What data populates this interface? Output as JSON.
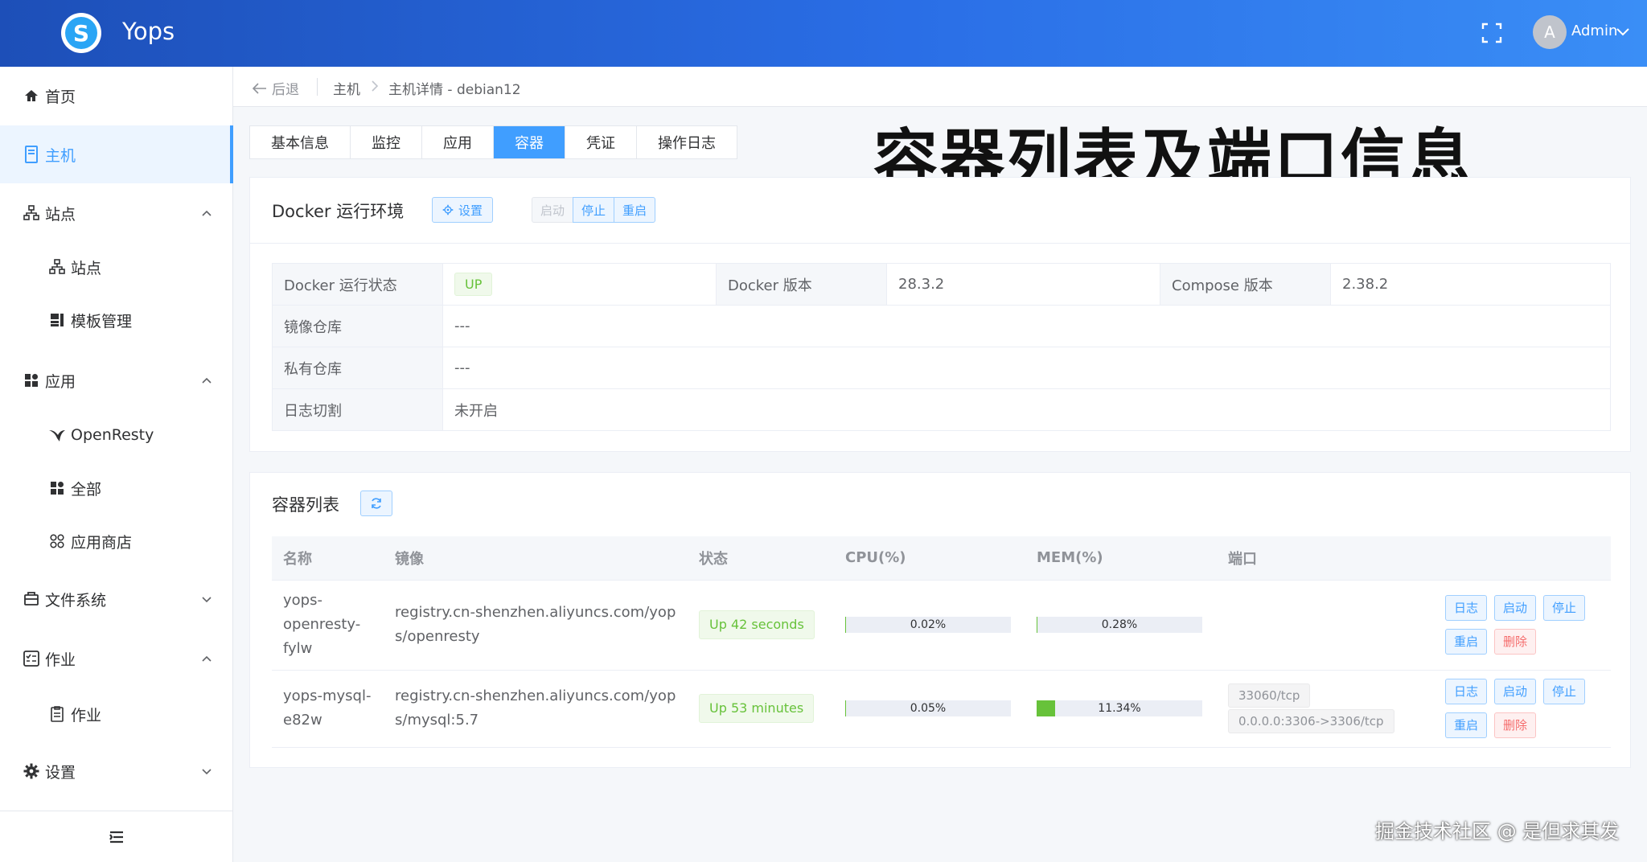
{
  "app": {
    "title": "Yops",
    "logo_letter": "S"
  },
  "header": {
    "user_initial": "A",
    "user_name": "Admin"
  },
  "sidebar": {
    "items": [
      {
        "label": "首页",
        "icon": "home-icon"
      },
      {
        "label": "主机",
        "icon": "server-icon",
        "active": true
      },
      {
        "label": "站点",
        "icon": "sitemap-icon",
        "expanded": true
      },
      {
        "label": "站点",
        "icon": "sitemap-icon",
        "sub": true
      },
      {
        "label": "模板管理",
        "icon": "template-icon",
        "sub": true
      },
      {
        "label": "应用",
        "icon": "apps-icon",
        "expanded": true
      },
      {
        "label": "OpenResty",
        "icon": "openresty-icon",
        "sub": true
      },
      {
        "label": "全部",
        "icon": "apps-icon",
        "sub": true
      },
      {
        "label": "应用商店",
        "icon": "store-icon",
        "sub": true
      },
      {
        "label": "文件系统",
        "icon": "folder-icon",
        "expanded": false
      },
      {
        "label": "作业",
        "icon": "task-icon",
        "expanded": true
      },
      {
        "label": "作业",
        "icon": "document-icon",
        "sub": true
      },
      {
        "label": "设置",
        "icon": "gear-icon",
        "expanded": false
      }
    ]
  },
  "breadcrumb": {
    "back": "后退",
    "parent": "主机",
    "current": "主机详情 - debian12"
  },
  "tabs": [
    "基本信息",
    "监控",
    "应用",
    "容器",
    "凭证",
    "操作日志"
  ],
  "active_tab": "容器",
  "overlay_title": "容器列表及端口信息",
  "docker_env": {
    "title": "Docker 运行环境",
    "setting_label": "设置",
    "buttons": {
      "start": "启动",
      "stop": "停止",
      "restart": "重启"
    },
    "status_label": "Docker 运行状态",
    "status_value": "UP",
    "version_label": "Docker 版本",
    "version_value": "28.3.2",
    "compose_label": "Compose 版本",
    "compose_value": "2.38.2",
    "registry_label": "镜像仓库",
    "registry_value": "---",
    "private_label": "私有仓库",
    "private_value": "---",
    "logrotate_label": "日志切割",
    "logrotate_value": "未开启"
  },
  "containers": {
    "title": "容器列表",
    "columns": {
      "name": "名称",
      "image": "镜像",
      "status": "状态",
      "cpu": "CPU(%)",
      "mem": "MEM(%)",
      "ports": "端口"
    },
    "actions": {
      "log": "日志",
      "start": "启动",
      "stop": "停止",
      "restart": "重启",
      "delete": "删除"
    },
    "rows": [
      {
        "name": "yops-openresty-fylw",
        "image": "registry.cn-shenzhen.aliyuncs.com/yops/openresty",
        "status": "Up 42 seconds",
        "cpu": 0.02,
        "cpu_text": "0.02%",
        "mem": 0.28,
        "mem_text": "0.28%",
        "ports": []
      },
      {
        "name": "yops-mysql-e82w",
        "image": "registry.cn-shenzhen.aliyuncs.com/yops/mysql:5.7",
        "status": "Up 53 minutes",
        "cpu": 0.05,
        "cpu_text": "0.05%",
        "mem": 11.34,
        "mem_text": "11.34%",
        "ports": [
          "33060/tcp",
          "0.0.0.0:3306->3306/tcp"
        ]
      }
    ]
  },
  "watermark": "掘金技术社区 @ 是但求其发",
  "colors": {
    "primary": "#409eff",
    "success": "#67c23a",
    "danger": "#f56c6c",
    "header_start": "#1d4fb8",
    "header_end": "#3a8ef6"
  }
}
